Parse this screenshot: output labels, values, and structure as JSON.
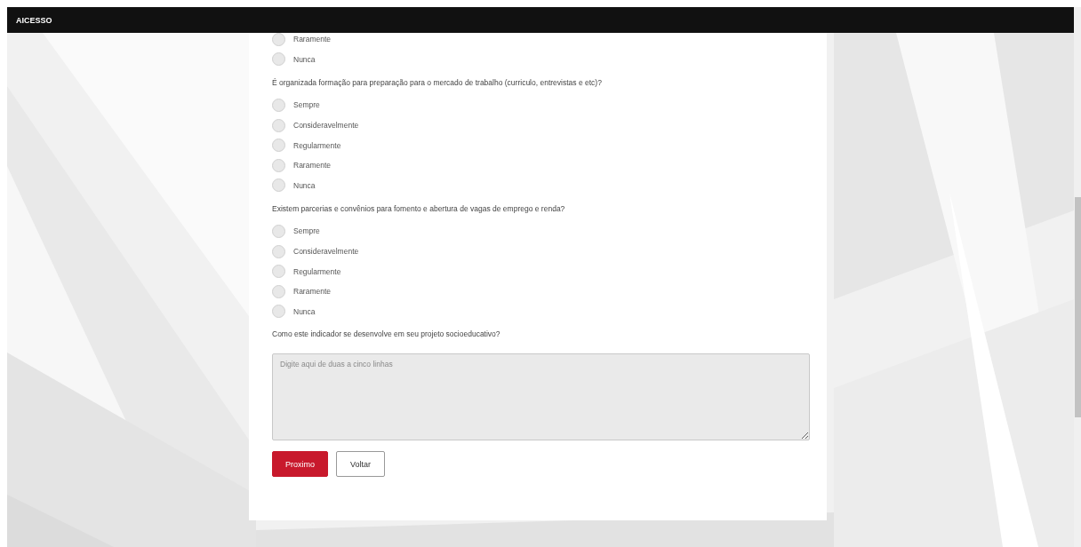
{
  "header": {
    "title": "AICESSO"
  },
  "groups": [
    {
      "options": [
        {
          "label": "Raramente",
          "selected": false
        },
        {
          "label": "Nunca",
          "selected": false
        }
      ]
    },
    {
      "question": "É organizada formação para preparação para o mercado de trabalho (curriculo, entrevistas e etc)?",
      "options": [
        {
          "label": "Sempre",
          "selected": false
        },
        {
          "label": "Consideravelmente",
          "selected": false
        },
        {
          "label": "Regularmente",
          "selected": false
        },
        {
          "label": "Raramente",
          "selected": false
        },
        {
          "label": "Nunca",
          "selected": false
        }
      ]
    },
    {
      "question": "Existem parcerias e convênios para fomento e abertura de vagas de emprego e renda?",
      "options": [
        {
          "label": "Sempre",
          "selected": false
        },
        {
          "label": "Consideravelmente",
          "selected": false
        },
        {
          "label": "Regularmente",
          "selected": false
        },
        {
          "label": "Raramente",
          "selected": false
        },
        {
          "label": "Nunca",
          "selected": false
        }
      ]
    }
  ],
  "open_question": {
    "question": "Como este indicador se desenvolve em seu projeto socioeducativo?",
    "placeholder": "Digite aqui de duas a cinco linhas"
  },
  "buttons": [
    {
      "label": "Proximo",
      "kind": "primary"
    },
    {
      "label": "Voltar",
      "kind": "secondary"
    }
  ]
}
